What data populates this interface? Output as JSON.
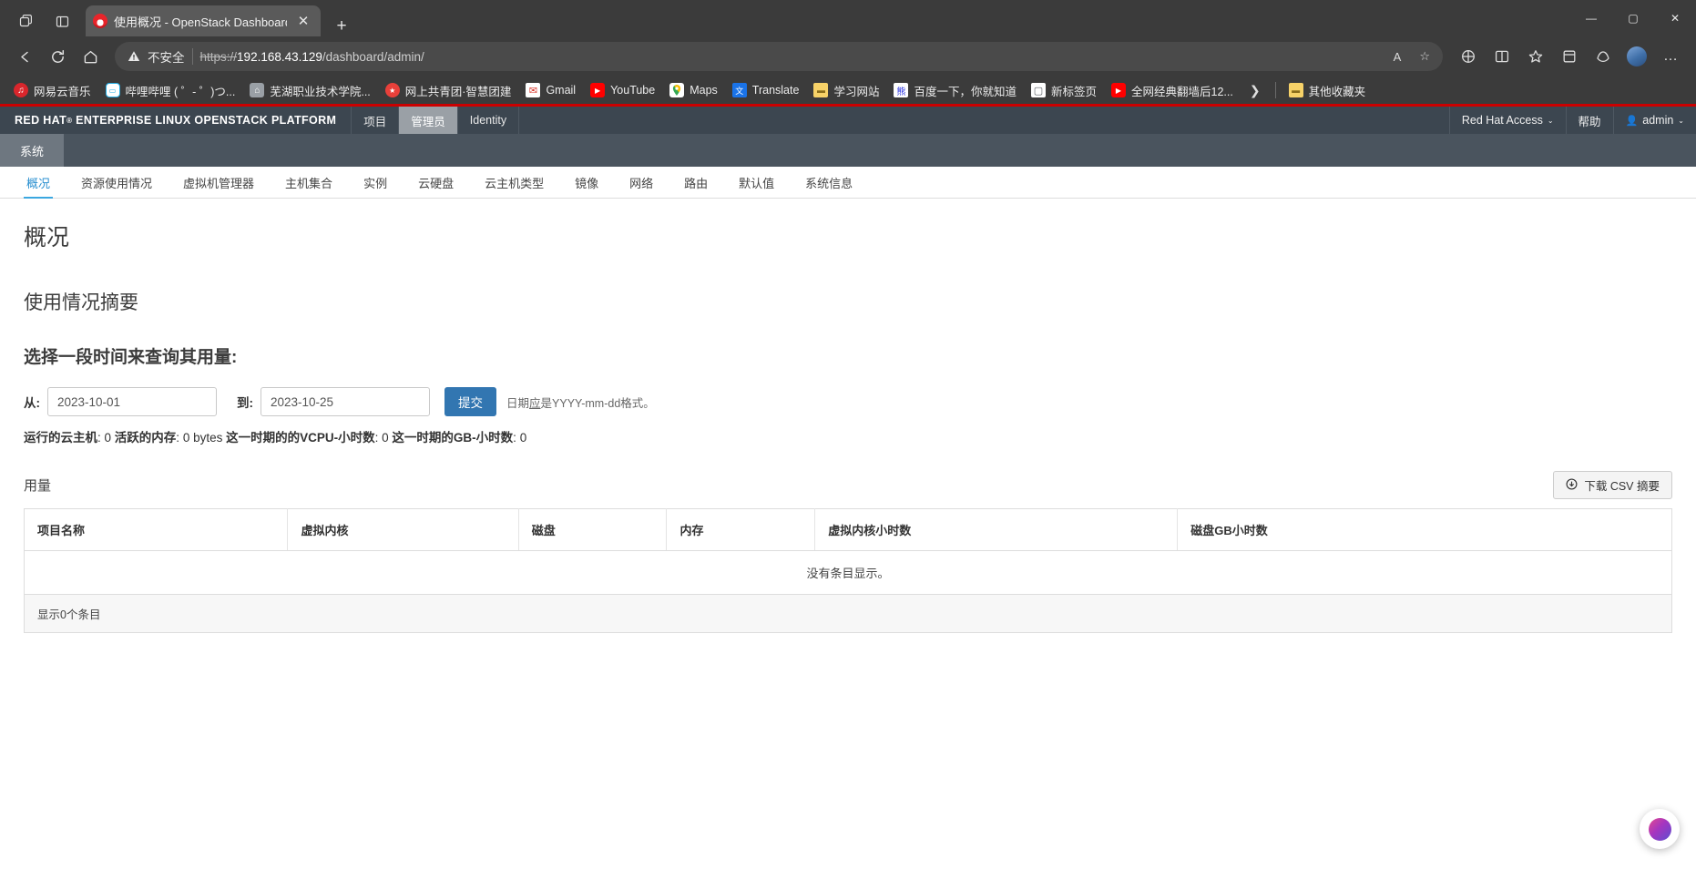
{
  "browser": {
    "tab": {
      "title": "使用概况 - OpenStack Dashboard",
      "close_label": "✕",
      "favicon_name": "redhat-favicon"
    },
    "new_tab_label": "+",
    "window_controls": {
      "minimize": "—",
      "maximize": "▢",
      "close": "✕"
    },
    "toolbar": {
      "back": "←",
      "reload": "⟳",
      "home": "⌂",
      "read_aloud": "A",
      "favorite": "☆",
      "collections_a": "◈",
      "split_screen": "▯",
      "favorites": "✦",
      "collections": "▤",
      "browser_essentials": "◉",
      "settings_more": "…"
    },
    "omnibox": {
      "warning_icon": "⚠",
      "warning_text": "不安全",
      "url_scheme": "https",
      "url_sep": "://",
      "url_host": "192.168.43.129",
      "url_path": "/dashboard/admin/"
    },
    "bookmarks": [
      {
        "label": "网易云音乐",
        "icon": "netease-music-icon",
        "glyph": "♫"
      },
      {
        "label": "哔哩哔哩 ( ゜- ゜)つ...",
        "icon": "bilibili-icon",
        "glyph": "tv"
      },
      {
        "label": "芜湖职业技术学院...",
        "icon": "school-icon",
        "glyph": "⌂"
      },
      {
        "label": "网上共青团·智慧团建",
        "icon": "youth-league-icon",
        "glyph": "★"
      },
      {
        "label": "Gmail",
        "icon": "gmail-icon",
        "glyph": "M"
      },
      {
        "label": "YouTube",
        "icon": "youtube-icon",
        "glyph": "▶"
      },
      {
        "label": "Maps",
        "icon": "google-maps-icon",
        "glyph": "📍"
      },
      {
        "label": "Translate",
        "icon": "google-translate-icon",
        "glyph": "文"
      },
      {
        "label": "学习网站",
        "icon": "folder-icon",
        "glyph": "▬"
      },
      {
        "label": "百度一下，你就知道",
        "icon": "baidu-icon",
        "glyph": "熊"
      },
      {
        "label": "新标签页",
        "icon": "new-tab-page-icon",
        "glyph": "▢"
      },
      {
        "label": "全网经典翻墙后12...",
        "icon": "youtube-icon",
        "glyph": "▶"
      }
    ],
    "bookmarks_overflow": "❯",
    "other_favorites": {
      "label": "其他收藏夹",
      "icon": "folder-icon",
      "glyph": "▬"
    }
  },
  "app": {
    "brand": "RED HAT",
    "brand_reg": "®",
    "brand_rest": "ENTERPRISE LINUX OPENSTACK PLATFORM",
    "nav": [
      {
        "label": "项目",
        "active": false
      },
      {
        "label": "管理员",
        "active": true
      },
      {
        "label": "Identity",
        "active": false
      }
    ],
    "right_nav": [
      {
        "label": "Red Hat Access",
        "caret": "⌄"
      },
      {
        "label": "帮助",
        "caret": ""
      },
      {
        "label": "admin",
        "caret": "⌄",
        "icon": "user-icon"
      }
    ],
    "subnav": {
      "label": "系统"
    },
    "tabs": [
      {
        "label": "概况",
        "active": true
      },
      {
        "label": "资源使用情况",
        "active": false
      },
      {
        "label": "虚拟机管理器",
        "active": false
      },
      {
        "label": "主机集合",
        "active": false
      },
      {
        "label": "实例",
        "active": false
      },
      {
        "label": "云硬盘",
        "active": false
      },
      {
        "label": "云主机类型",
        "active": false
      },
      {
        "label": "镜像",
        "active": false
      },
      {
        "label": "网络",
        "active": false
      },
      {
        "label": "路由",
        "active": false
      },
      {
        "label": "默认值",
        "active": false
      },
      {
        "label": "系统信息",
        "active": false
      }
    ],
    "page_title": "概况",
    "section_title": "使用情况摘要",
    "form_title": "选择一段时间来查询其用量:",
    "form": {
      "from_label": "从:",
      "from_value": "2023-10-01",
      "to_label": "到:",
      "to_value": "2023-10-25",
      "submit_label": "提交",
      "hint_prefix": "日期",
      "hint_underline": "应",
      "hint_suffix": "是YYYY-mm-dd格式。"
    },
    "stats": {
      "running_label": "运行的云主机",
      "running_value": "0",
      "memory_label": "活跃的内存",
      "memory_value": "0 bytes",
      "vcpu_label": "这一时期的的VCPU-小时数",
      "vcpu_value": "0",
      "gb_label": "这一时期的GB-小时数",
      "gb_value": "0"
    },
    "usage": {
      "title": "用量",
      "csv_label": "下载 CSV 摘要",
      "csv_icon": "download-icon",
      "columns": [
        "项目名称",
        "虚拟内核",
        "磁盘",
        "内存",
        "虚拟内核小时数",
        "磁盘GB小时数"
      ],
      "empty_message": "没有条目显示。",
      "footer_count": "显示0个条目"
    }
  },
  "copilot": {
    "name": "copilot-button"
  }
}
